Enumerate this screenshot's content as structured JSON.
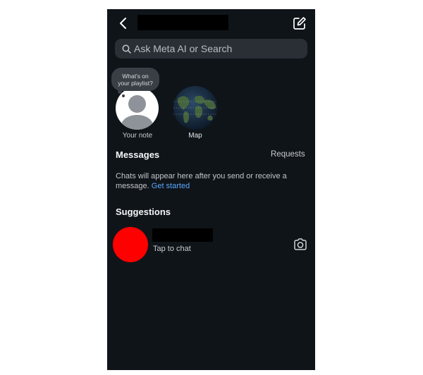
{
  "header": {
    "title": ""
  },
  "search": {
    "placeholder": "Ask Meta AI or Search"
  },
  "notes": [
    {
      "bubble_text": "What's on your playlist?",
      "label": "Your note"
    },
    {
      "label": "Map"
    }
  ],
  "messages": {
    "heading": "Messages",
    "requests_label": "Requests",
    "empty_text": "Chats will appear here after you send or receive a message.",
    "get_started": "Get started"
  },
  "suggestions": {
    "heading": "Suggestions",
    "items": [
      {
        "name": "",
        "subtitle": "Tap to chat"
      }
    ]
  },
  "colors": {
    "background": "#0f1419",
    "search_bg": "#2a2f36",
    "link": "#58a8ff",
    "suggestion_avatar": "#ff0000"
  },
  "icons": {
    "back": "chevron-left-icon",
    "compose": "compose-icon",
    "search": "search-icon",
    "camera": "camera-icon"
  }
}
